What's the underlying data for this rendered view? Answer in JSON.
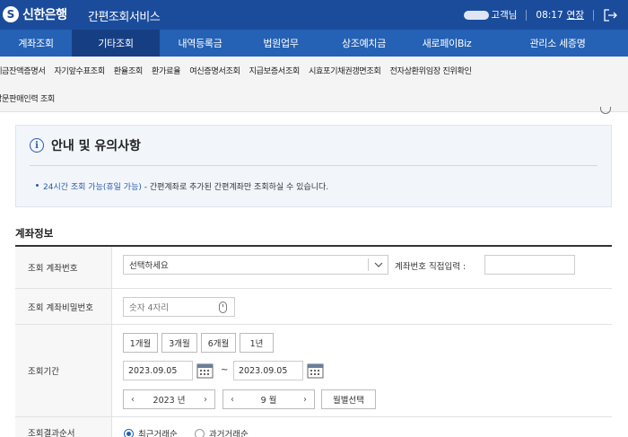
{
  "header": {
    "logo_mark": "S",
    "logo_text": "신한은행",
    "service_name": "간편조회서비스",
    "user_suffix": "고객님",
    "time": "08:17",
    "extend_label": "연장"
  },
  "main_nav": [
    {
      "label": "계좌조회"
    },
    {
      "label": "기타조회"
    },
    {
      "label": "내역등록금"
    },
    {
      "label": "법원업무"
    },
    {
      "label": "상조예치금"
    },
    {
      "label": "새로페이Biz"
    },
    {
      "label": "관리소 세증명"
    }
  ],
  "sub_nav": {
    "row1": [
      "예금잔액증명서",
      "자기앞수표조회",
      "환율조회",
      "환가료율",
      "여신증명서조회",
      "지급보증서조회",
      "시효포기채권갱면조회",
      "전자상환위임장 진위확인"
    ],
    "row2": [
      "방문판매인력 조회"
    ]
  },
  "notice": {
    "title": "안내 및 유의사항",
    "highlight": "24시간 조회 가능(휴일 가능)",
    "text": " - 간편계좌로 추가된 간편계좌만 조회하실 수 있습니다."
  },
  "section_title": "계좌정보",
  "form": {
    "account_label": "조회 계좌번호",
    "account_select_value": "선택하세요",
    "direct_input_label": "계좌번호 직접입력 :",
    "password_label": "조회 계좌비밀번호",
    "password_placeholder": "숫자 4자리",
    "period_label": "조회기간",
    "period_buttons": [
      "1개월",
      "3개월",
      "6개월",
      "1년"
    ],
    "start_date": "2023.09.05",
    "end_date": "2023.09.05",
    "range_sep": "~",
    "year_value": "2023 년",
    "month_value": "9 월",
    "month_select_button": "월별선택",
    "order_label": "조회결과순서",
    "order_options": [
      "최근거래순",
      "과거거래순"
    ]
  },
  "colors": {
    "header_bg": "#1b4c9c",
    "nav_bg": "#2561b4",
    "nav_active_bg": "#163f83",
    "accent": "#2a5ca8"
  }
}
